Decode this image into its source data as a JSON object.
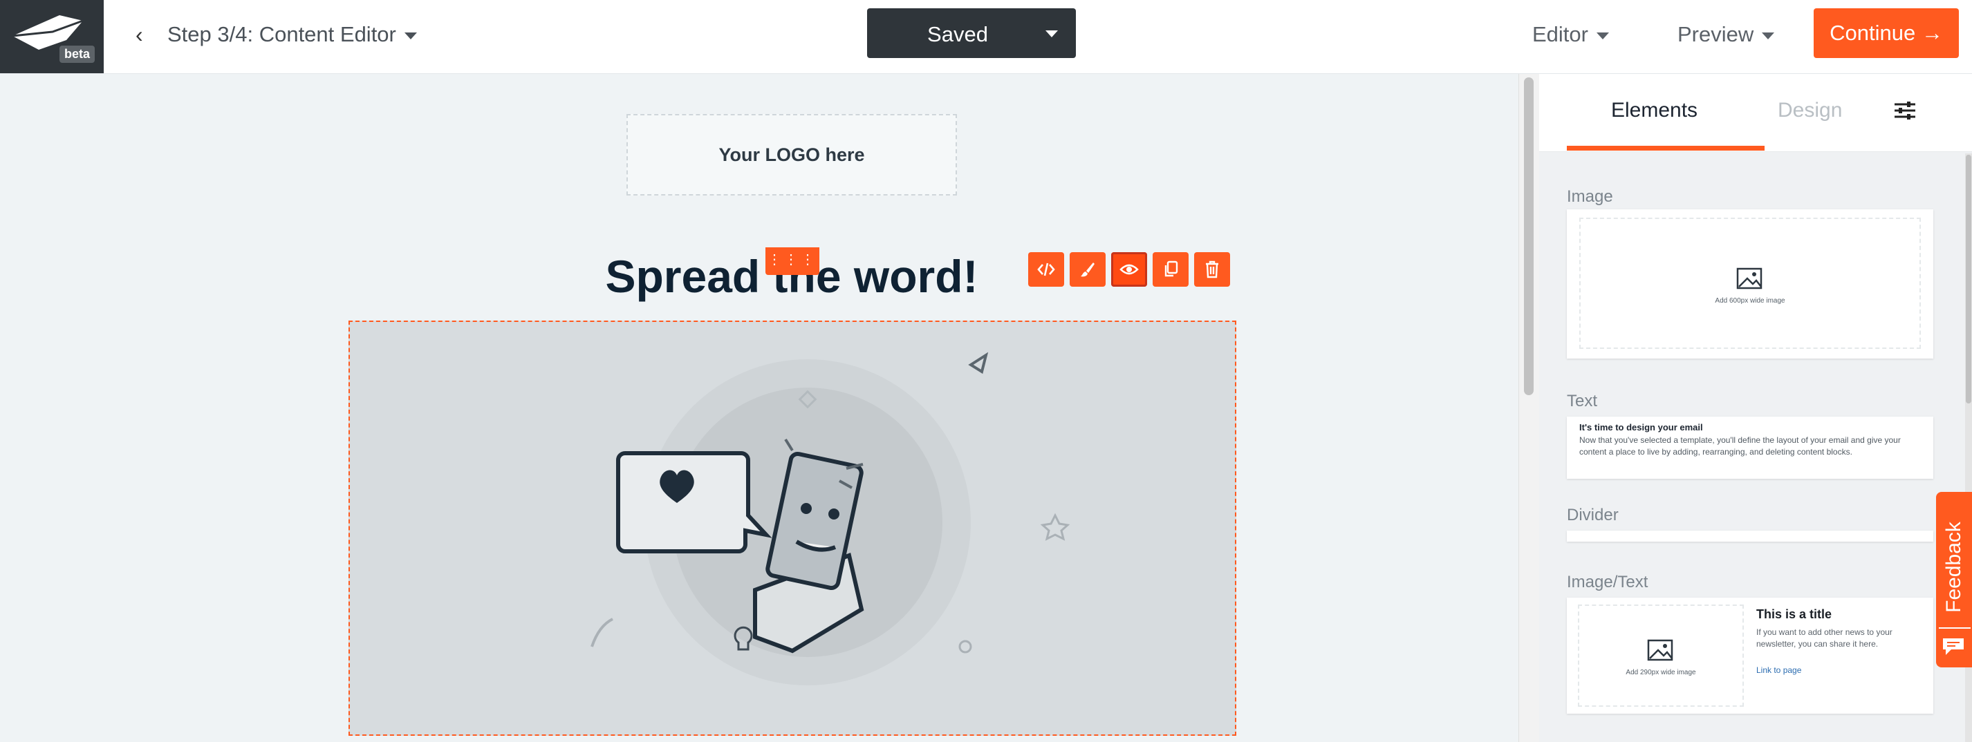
{
  "header": {
    "brand_badge": "beta",
    "back_label": "‹",
    "step_title": "Step 3/4: Content Editor",
    "save_status": "Saved",
    "menu_editor": "Editor",
    "menu_preview": "Preview",
    "continue_label": "Continue →"
  },
  "canvas": {
    "logo_placeholder": "Your LOGO here",
    "headline": "Spread the word!",
    "drag_handle": "⋮⋮⋮",
    "toolbar": [
      "code-icon",
      "brush-icon",
      "eye-icon",
      "copy-icon",
      "trash-icon"
    ]
  },
  "panel": {
    "tabs": {
      "elements": "Elements",
      "design": "Design"
    },
    "sections": {
      "image": {
        "label": "Image",
        "caption": "Add 600px wide image"
      },
      "text": {
        "label": "Text",
        "title": "It's time to design your email",
        "body": "Now that you've selected a template, you'll define the layout of your email and give your content a place to live by adding, rearranging, and deleting content blocks."
      },
      "divider": {
        "label": "Divider"
      },
      "image_text": {
        "label": "Image/Text",
        "caption": "Add 290px wide image",
        "title": "This is a title",
        "body": "If you want to add other news to your newsletter, you can share it here.",
        "link": "Link to page"
      }
    },
    "feedback_label": "Feedback"
  },
  "colors": {
    "accent": "#ff5a1f",
    "dark": "#2f353a",
    "canvas_bg": "#eff3f5"
  }
}
